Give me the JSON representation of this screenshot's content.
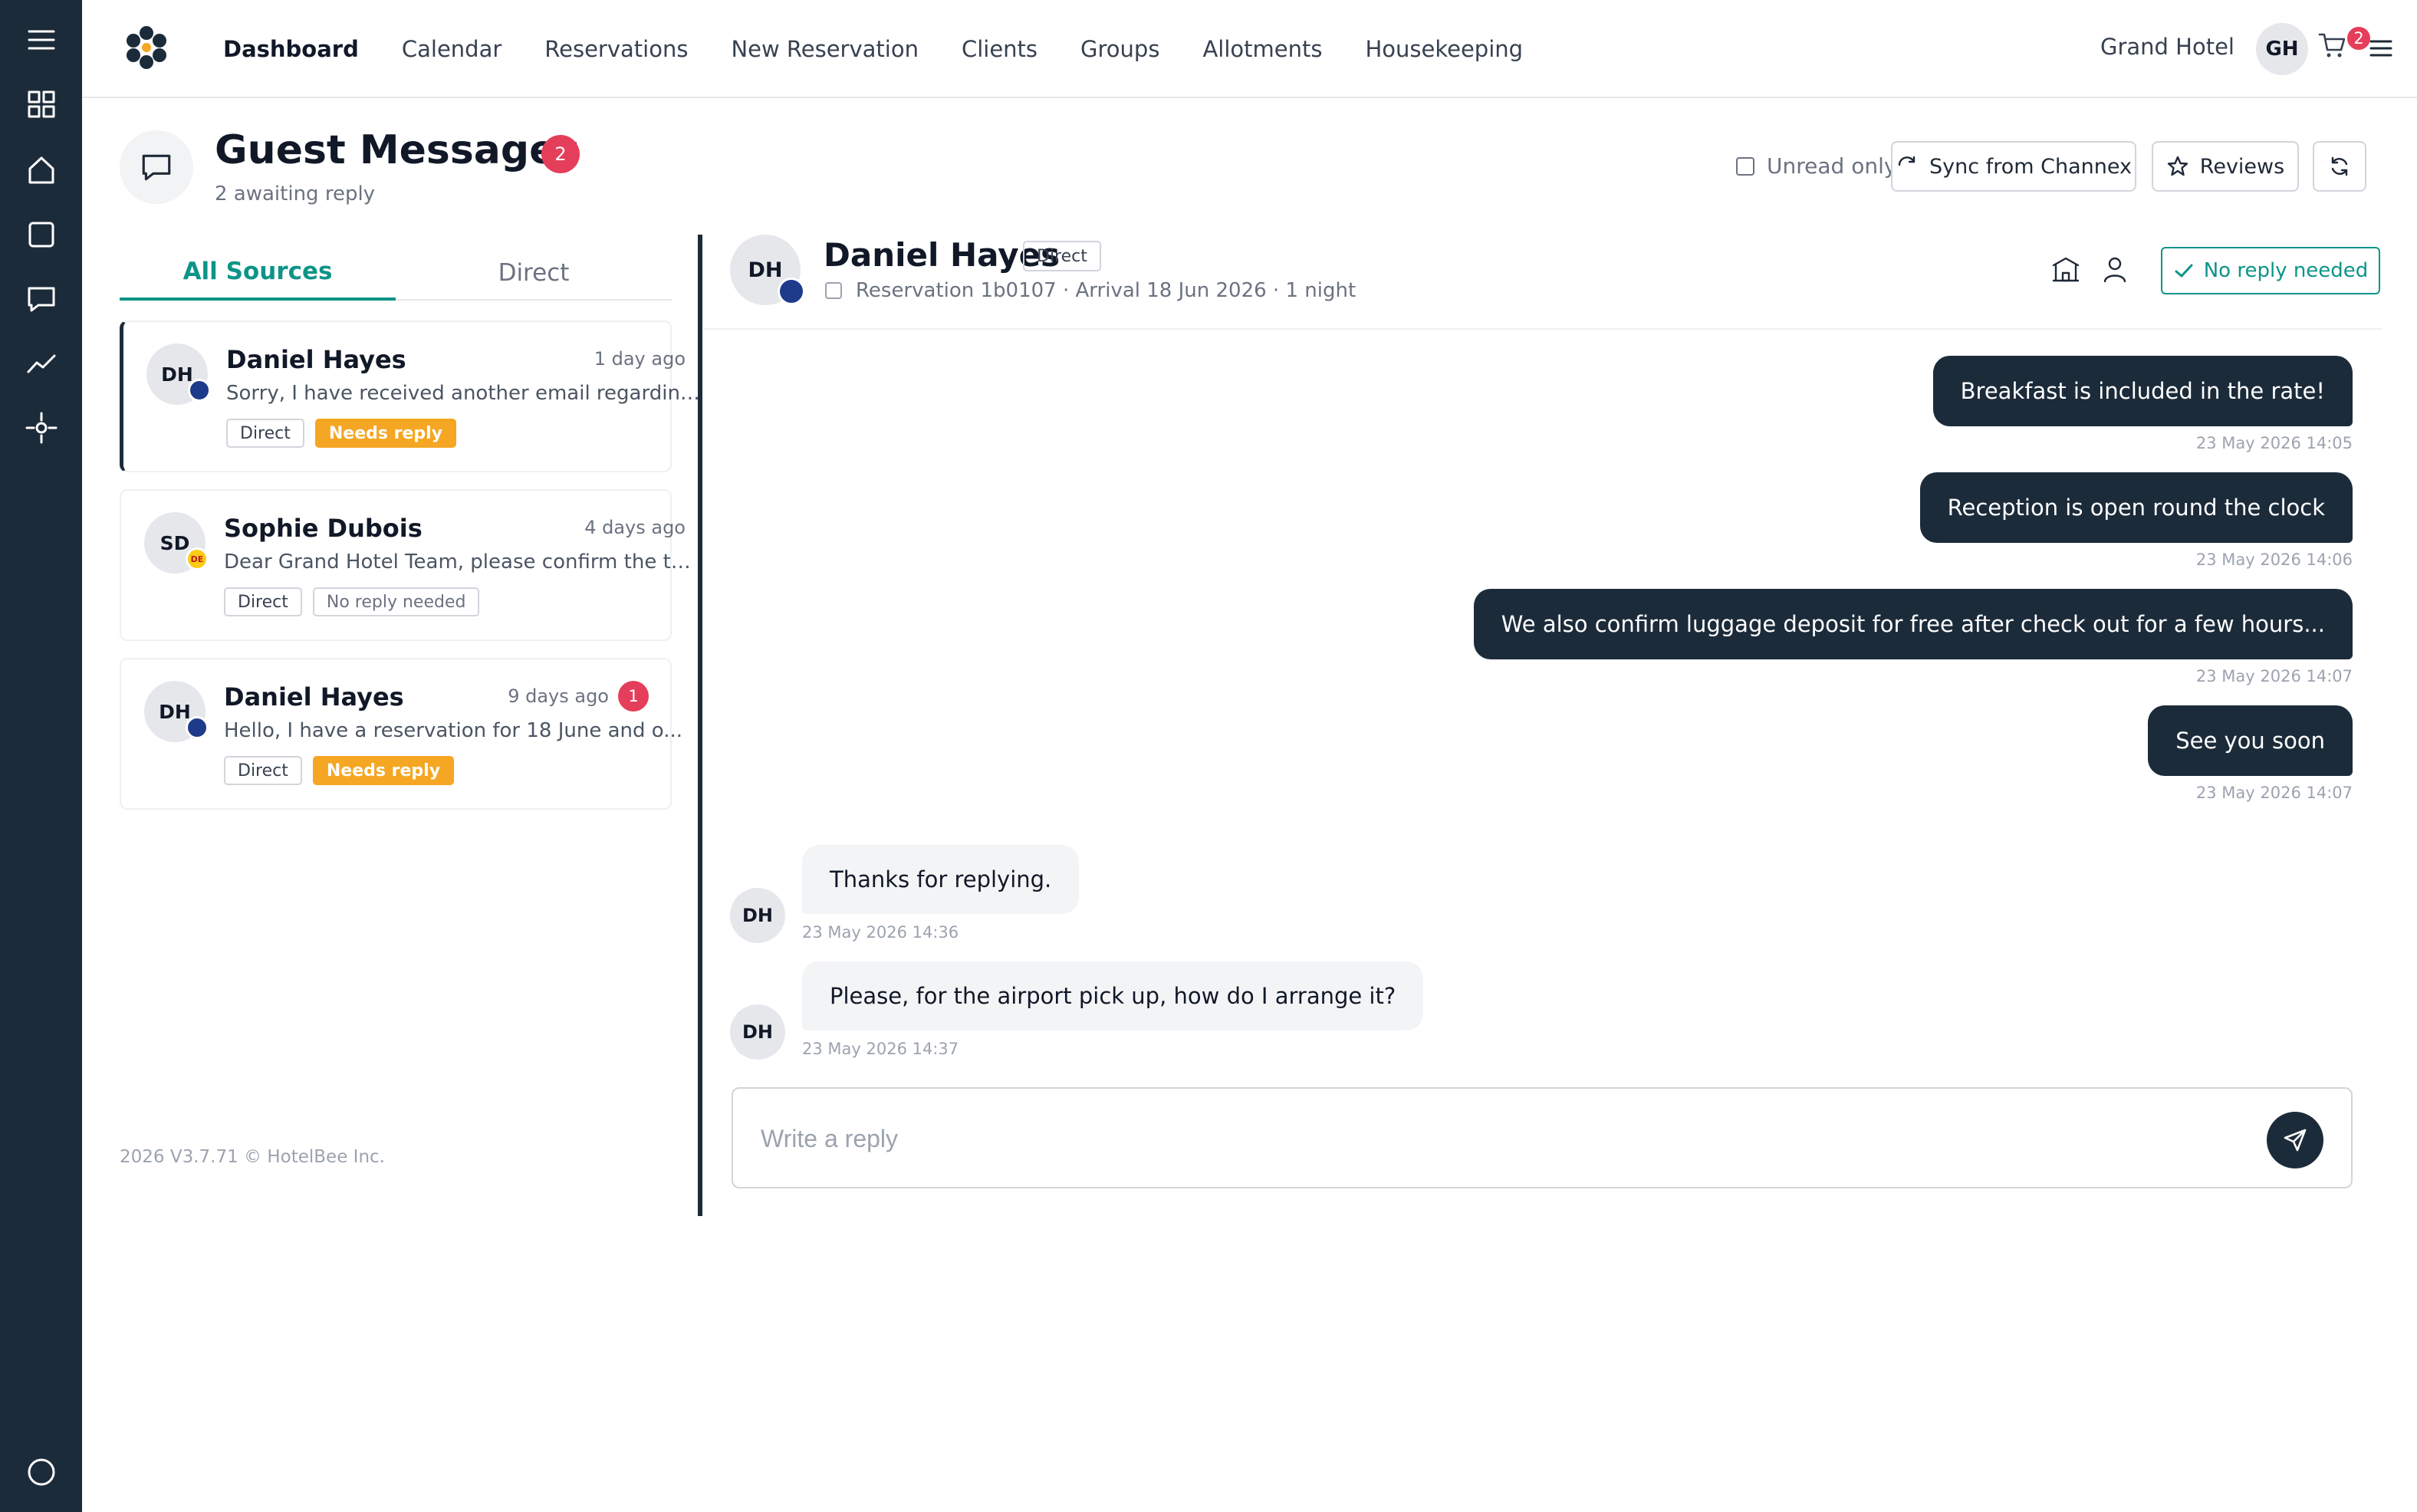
{
  "nav": {
    "items": [
      "Dashboard",
      "Calendar",
      "Reservations",
      "New Reservation",
      "Clients",
      "Groups",
      "Allotments",
      "Housekeeping"
    ],
    "active": "Dashboard",
    "hotel_name": "Grand Hotel",
    "user_initials": "GH",
    "cart_count": "2"
  },
  "sidebar": {
    "icons": [
      "menu-icon",
      "grid-icon",
      "home-icon",
      "square-icon",
      "chat-icon",
      "trend-icon",
      "target-icon",
      "circle-icon"
    ],
    "active_icon": "chat-icon"
  },
  "header": {
    "title": "Guest Messages",
    "badge": "2",
    "subtitle": "2 awaiting reply",
    "unread_only": "Unread only",
    "sync_label": "Sync from Channex",
    "reviews_label": "Reviews"
  },
  "tabs": [
    {
      "label": "All Sources",
      "active": true
    },
    {
      "label": "Direct",
      "active": false
    }
  ],
  "conversations": [
    {
      "initials": "DH",
      "name": "Daniel Hayes",
      "time": "1 day ago",
      "preview": "Sorry, I have received another email regarding airp...",
      "chips": [
        "Direct",
        "Needs reply"
      ],
      "selected": true
    },
    {
      "initials": "SD",
      "name": "Sophie Dubois",
      "time": "4 days ago",
      "preview": "Dear Grand Hotel Team, please confirm the transfer...",
      "chips": [
        "Direct",
        "No reply needed"
      ],
      "flag": "DE"
    },
    {
      "initials": "DH",
      "name": "Daniel Hayes",
      "time": "9 days ago",
      "unread": "1",
      "preview": "Hello, I have a reservation for 18 June and o...",
      "chips": [
        "Direct",
        "Needs reply"
      ]
    }
  ],
  "footer": "2026 V3.7.71 © HotelBee Inc.",
  "chat": {
    "initials": "DH",
    "name": "Daniel Hayes",
    "chip": "Direct",
    "meta": "Reservation 1b0107 · Arrival 18 Jun 2026 · 1 night",
    "no_reply_label": "No reply needed",
    "messages_out": [
      {
        "text": "Breakfast is included in the rate!",
        "time": "23 May 2026 14:05"
      },
      {
        "text": "Reception is open round the clock",
        "time": "23 May 2026 14:06"
      },
      {
        "text": "We also confirm luggage deposit for free after check out for a few hours...",
        "time": "23 May 2026 14:07"
      },
      {
        "text": "See you soon",
        "time": "23 May 2026 14:07"
      }
    ],
    "messages_in": [
      {
        "initials": "DH",
        "text": "Thanks for replying.",
        "time": "23 May 2026 14:36"
      },
      {
        "initials": "DH",
        "text": "Please, for the airport pick up, how do I arrange it?",
        "time": "23 May 2026 14:37"
      }
    ],
    "reply_placeholder": "Write a reply"
  },
  "colors": {
    "rail": "#1c2b3a",
    "accent": "#0d9488",
    "badge": "#e53e5a",
    "needs_reply": "#f5a623"
  }
}
